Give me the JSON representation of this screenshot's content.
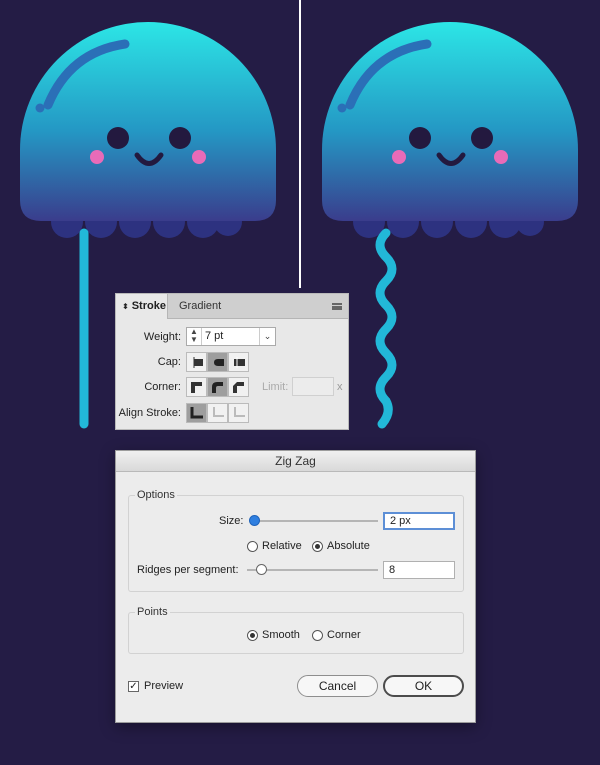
{
  "stroke_panel": {
    "tabs": [
      "Stroke",
      "Gradient"
    ],
    "weight_label": "Weight:",
    "weight_value": "7 pt",
    "cap_label": "Cap:",
    "corner_label": "Corner:",
    "limit_label": "Limit:",
    "limit_unit": "x",
    "align_label": "Align Stroke:"
  },
  "dialog": {
    "title": "Zig Zag",
    "options_legend": "Options",
    "size_label": "Size:",
    "size_value": "2 px",
    "relative_label": "Relative",
    "absolute_label": "Absolute",
    "ridges_label": "Ridges per segment:",
    "ridges_value": "8",
    "points_legend": "Points",
    "smooth_label": "Smooth",
    "corner_label": "Corner",
    "preview_label": "Preview",
    "preview_checked": true,
    "cancel_label": "Cancel",
    "ok_label": "OK"
  },
  "colors": {
    "background": "#241c45",
    "body_top": "#2ce6e6",
    "body_bottom": "#3a3d8c",
    "tentacle": "#22b8d8",
    "cheek": "#e86bb8"
  }
}
